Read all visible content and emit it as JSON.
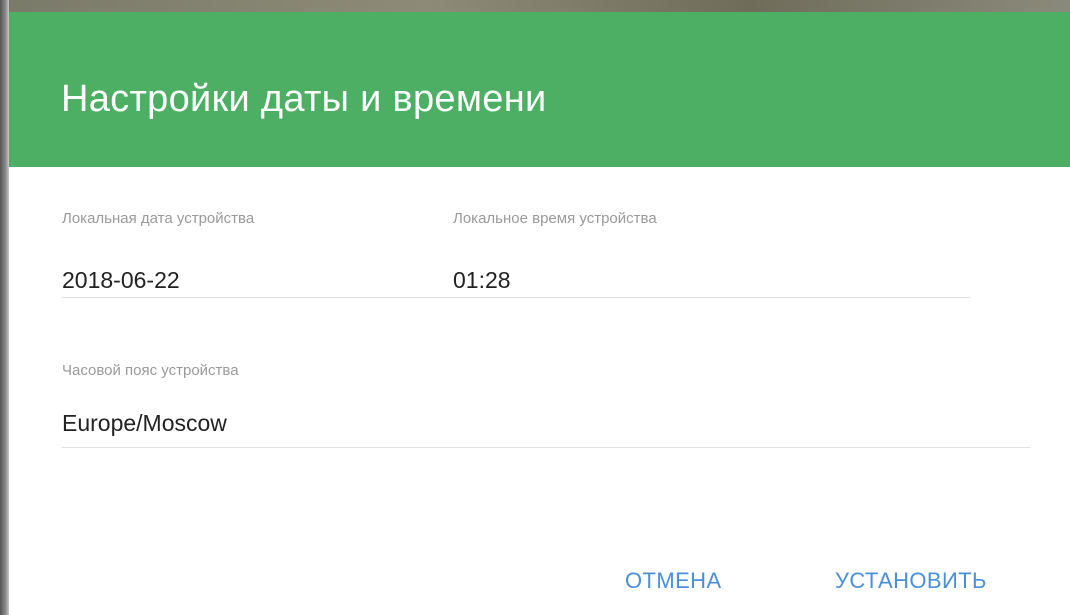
{
  "dialog": {
    "title": "Настройки даты и времени",
    "header_color": "#4caf63",
    "fields": {
      "date": {
        "label": "Локальная дата устройства",
        "value": "2018-06-22"
      },
      "time": {
        "label": "Локальное время устройства",
        "value": "01:28"
      },
      "timezone": {
        "label": "Часовой пояс устройства",
        "value": "Europe/Moscow"
      }
    },
    "actions": {
      "cancel_label": "ОТМЕНА",
      "set_label": "УСТАНОВИТЬ",
      "accent_color": "#4a90d9"
    }
  }
}
